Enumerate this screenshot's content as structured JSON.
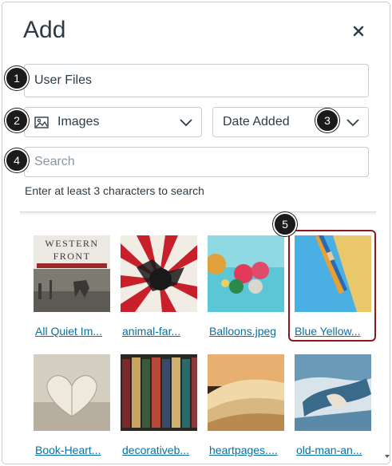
{
  "dialog": {
    "title": "Add",
    "close_icon": "close-icon"
  },
  "source": {
    "value": "User Files"
  },
  "type_filter": {
    "icon": "image-icon",
    "value": "Images"
  },
  "sort_filter": {
    "value": "Date Added"
  },
  "search": {
    "placeholder": "Search",
    "hint": "Enter at least 3 characters to search"
  },
  "callouts": [
    "1",
    "2",
    "3",
    "4",
    "5"
  ],
  "images": [
    {
      "label": "All Quiet Im..."
    },
    {
      "label": "animal-far..."
    },
    {
      "label": "Balloons.jpeg"
    },
    {
      "label": "Blue Yellow..."
    },
    {
      "label": "Book-Heart..."
    },
    {
      "label": "decorativeb..."
    },
    {
      "label": "heartpages...."
    },
    {
      "label": "old-man-an..."
    }
  ],
  "book_cover": {
    "line1": "WESTERN",
    "line2": "FRONT"
  },
  "colors": {
    "link": "#0770a3",
    "text": "#2d3b45",
    "selected_border": "#8b1a1a",
    "badge": "#1b1b1b"
  }
}
